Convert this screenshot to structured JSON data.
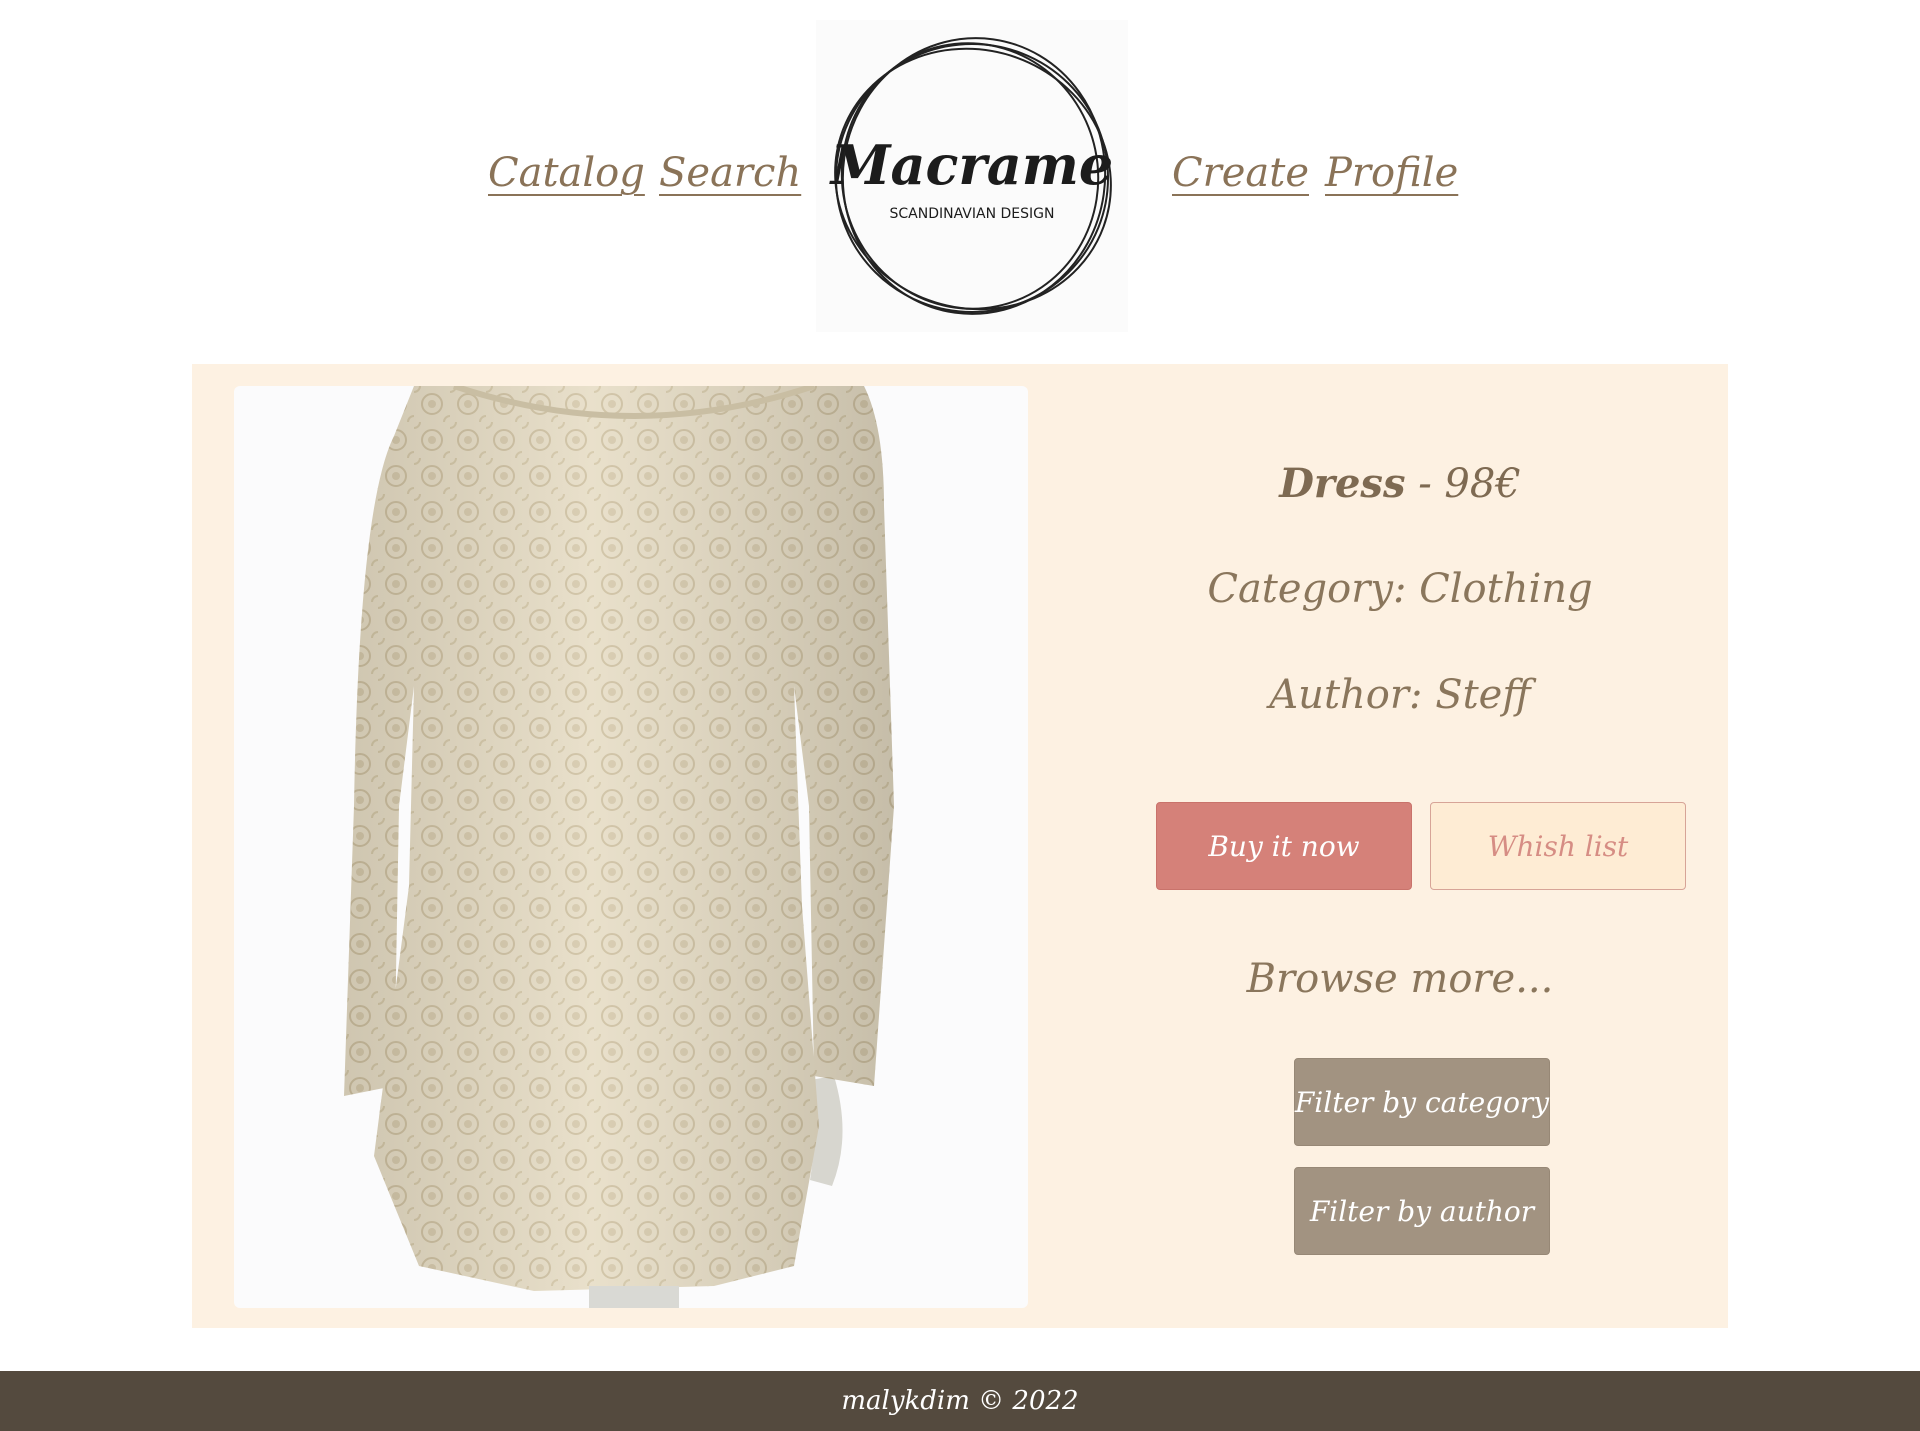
{
  "nav": {
    "catalog": "Catalog",
    "search": "Search",
    "create": "Create",
    "profile": "Profile"
  },
  "logo": {
    "name": "Macrame",
    "tagline": "SCANDINAVIAN DESIGN"
  },
  "product": {
    "name": "Dress",
    "price_separator": "-",
    "price": "98€",
    "category_label": "Category:",
    "category": "Clothing",
    "author_label": "Author:",
    "author": "Steff",
    "image_alt_icon": "dress-photo"
  },
  "actions": {
    "buy": "Buy it now",
    "wishlist": "Whish list"
  },
  "browse": {
    "heading": "Browse more...",
    "filter_category": "Filter by category",
    "filter_author": "Filter by author"
  },
  "footer": {
    "text": "malykdim © 2022"
  },
  "colors": {
    "card_bg": "#fdf1e2",
    "text_brown": "#7e6a52",
    "buy_button": "#d58179",
    "wishlist_button": "#feecd4",
    "filter_button": "#a29381",
    "footer_bg": "#544a3e"
  }
}
